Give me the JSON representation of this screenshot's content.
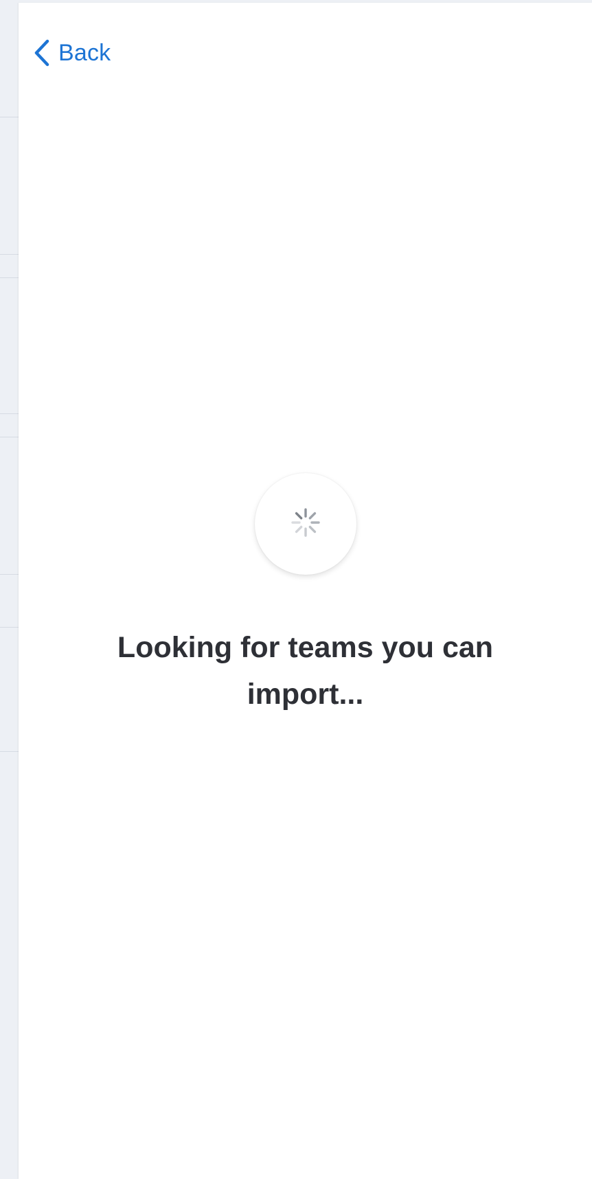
{
  "header": {
    "back_label": "Back"
  },
  "loader": {
    "message": "Looking for teams you can import..."
  },
  "icons": {
    "back": "chevron-left-icon",
    "spinner": "spinner-icon"
  },
  "colors": {
    "accent": "#1d74d4",
    "text": "#2e3036",
    "underlay": "#edf0f5"
  }
}
